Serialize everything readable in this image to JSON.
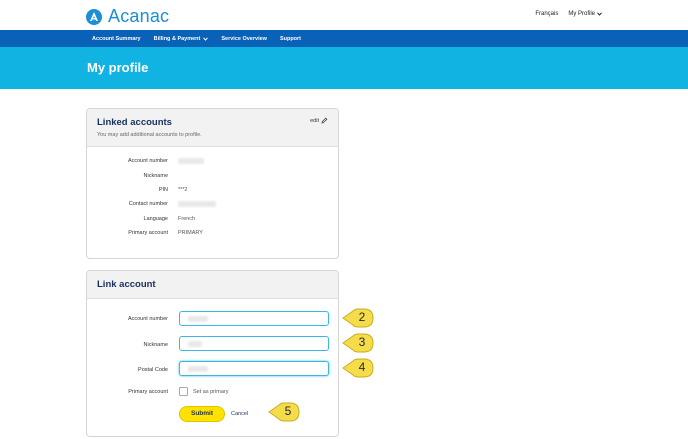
{
  "header": {
    "brand": "Acanac",
    "lang_link": "Français",
    "profile_link": "My Profile"
  },
  "nav": {
    "items": [
      {
        "label": "Account Summary"
      },
      {
        "label": "Billing & Payment"
      },
      {
        "label": "Service Overview"
      },
      {
        "label": "Support"
      }
    ]
  },
  "page": {
    "title": "My profile"
  },
  "linked_accounts": {
    "title": "Linked accounts",
    "subtitle": "You may add additional accounts to profile.",
    "edit_label": "edit",
    "rows": [
      {
        "label": "Account number",
        "value": ""
      },
      {
        "label": "Nickname",
        "value": ""
      },
      {
        "label": "PIN",
        "value": "***2"
      },
      {
        "label": "Contact number",
        "value": ""
      },
      {
        "label": "Language",
        "value": "French"
      },
      {
        "label": "Primary account",
        "value": "PRIMARY"
      }
    ]
  },
  "link_account": {
    "title": "Link account",
    "fields": [
      {
        "label": "Account number",
        "value": ""
      },
      {
        "label": "Nickname",
        "value": ""
      },
      {
        "label": "Postal Code",
        "value": ""
      }
    ],
    "primary_label": "Primary account",
    "set_primary_label": "Set as primary",
    "submit_label": "Submit",
    "cancel_label": "Cancel"
  },
  "callouts": [
    "2",
    "3",
    "4",
    "5"
  ],
  "colors": {
    "brand_blue": "#1a8fd6",
    "nav_blue": "#0a62b8",
    "hero_cyan": "#11b3e2",
    "submit_yellow": "#ffe200",
    "callout_yellow": "#f5dc4a"
  }
}
